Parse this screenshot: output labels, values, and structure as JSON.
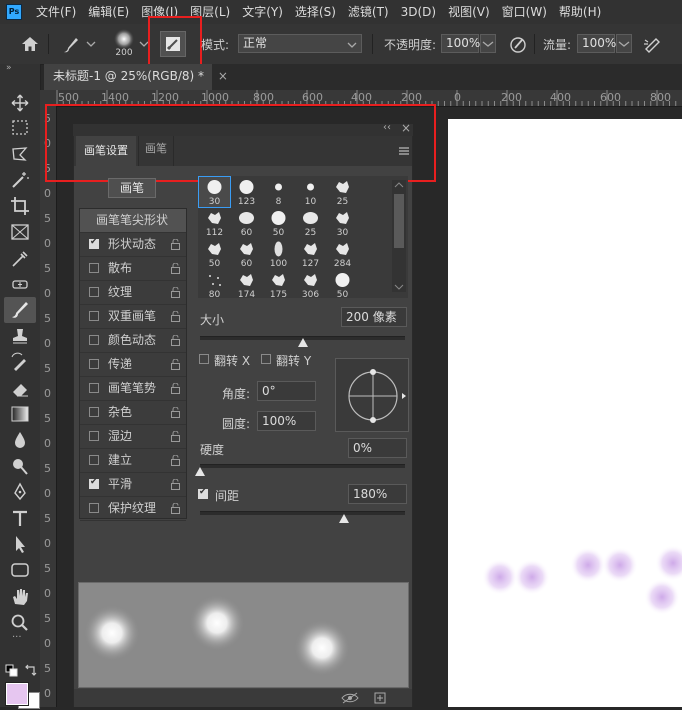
{
  "menubar": {
    "logo": "Ps",
    "items": [
      "文件(F)",
      "编辑(E)",
      "图像(I)",
      "图层(L)",
      "文字(Y)",
      "选择(S)",
      "滤镜(T)",
      "3D(D)",
      "视图(V)",
      "窗口(W)",
      "帮助(H)"
    ]
  },
  "options_bar": {
    "brush_size": "200",
    "mode_label": "模式:",
    "mode_value": "正常",
    "opacity_label": "不透明度:",
    "opacity_value": "100%",
    "flow_label": "流量:",
    "flow_value": "100%"
  },
  "document_tab": {
    "title": "未标题-1 @ 25%(RGB/8) *",
    "close": "×"
  },
  "ruler": {
    "top": [
      "500",
      "1400",
      "1200",
      "1000",
      "800",
      "600",
      "400",
      "200",
      "0",
      "200",
      "400",
      "600",
      "800"
    ],
    "left": [
      "5",
      "0",
      "5",
      "0",
      "5",
      "0",
      "5",
      "0",
      "5",
      "0",
      "5",
      "0",
      "5",
      "0",
      "5",
      "0",
      "5",
      "0",
      "5",
      "0",
      "5",
      "0",
      "5",
      "0"
    ]
  },
  "panel": {
    "collapse_icon": "‹‹",
    "close_icon": "×",
    "tabs": [
      "画笔设置",
      "画笔"
    ],
    "brush_button": "画笔",
    "options": [
      {
        "label": "画笔笔尖形状",
        "checkbox": false,
        "checked": false,
        "lock": false,
        "selected": true
      },
      {
        "label": "形状动态",
        "checkbox": true,
        "checked": true,
        "lock": true,
        "selected": false
      },
      {
        "label": "散布",
        "checkbox": true,
        "checked": false,
        "lock": true,
        "selected": false
      },
      {
        "label": "纹理",
        "checkbox": true,
        "checked": false,
        "lock": true,
        "selected": false
      },
      {
        "label": "双重画笔",
        "checkbox": true,
        "checked": false,
        "lock": true,
        "selected": false
      },
      {
        "label": "颜色动态",
        "checkbox": true,
        "checked": false,
        "lock": true,
        "selected": false
      },
      {
        "label": "传递",
        "checkbox": true,
        "checked": false,
        "lock": true,
        "selected": false
      },
      {
        "label": "画笔笔势",
        "checkbox": true,
        "checked": false,
        "lock": true,
        "selected": false
      },
      {
        "label": "杂色",
        "checkbox": true,
        "checked": false,
        "lock": true,
        "selected": false
      },
      {
        "label": "湿边",
        "checkbox": true,
        "checked": false,
        "lock": true,
        "selected": false
      },
      {
        "label": "建立",
        "checkbox": true,
        "checked": false,
        "lock": true,
        "selected": false
      },
      {
        "label": "平滑",
        "checkbox": true,
        "checked": true,
        "lock": true,
        "selected": false
      },
      {
        "label": "保护纹理",
        "checkbox": true,
        "checked": false,
        "lock": true,
        "selected": false
      }
    ],
    "presets": [
      "30",
      "123",
      "8",
      "10",
      "25",
      "112",
      "60",
      "50",
      "25",
      "30",
      "50",
      "60",
      "100",
      "127",
      "284",
      "80",
      "174",
      "175",
      "306",
      "50"
    ],
    "size_label": "大小",
    "size_value": "200 像素",
    "flip_x": "翻转 X",
    "flip_y": "翻转 Y",
    "angle_label": "角度:",
    "angle_value": "0°",
    "roundness_label": "圆度:",
    "roundness_value": "100%",
    "hardness_label": "硬度",
    "hardness_value": "0%",
    "spacing_label": "间距",
    "spacing_value": "180%",
    "size_slider_level": 0.5,
    "hardness_slider_level": 0.0,
    "spacing_slider_level": 0.7
  },
  "colors": {
    "accent": "#e81f1f",
    "foreground": "#e6c6f0",
    "background": "#ffffff",
    "stroke_purple": "#c9a0e6"
  }
}
